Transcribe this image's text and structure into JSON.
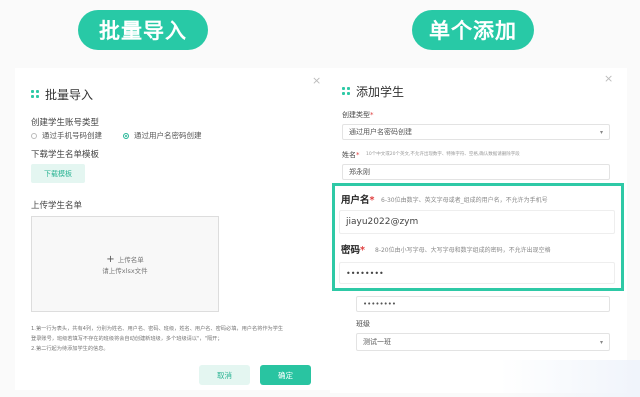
{
  "labels": {
    "left": "批量导入",
    "right": "单个添加"
  },
  "batch": {
    "close": "×",
    "title": "批量导入",
    "account_type_label": "创建学生账号类型",
    "radio_phone": "通过手机号码创建",
    "radio_username": "通过用户名密码创建",
    "download_label": "下载学生名单模板",
    "download_button": "下载模板",
    "upload_label": "上传学生名单",
    "upload_title": "上传名单",
    "upload_hint": "请上传xlsx文件",
    "note1": "1.第一行为表头，共有4列，分别为姓名、用户名、密码、班级，姓名、用户名、密码必填，用户名将作为学生",
    "note2": "登录账号，班级若填写不存在的班级将会自动创建新班级，多个班级请以\"，\"隔开；",
    "note3": "2.第二行起为待添加学生的信息。",
    "cancel": "取消",
    "confirm": "确定"
  },
  "single": {
    "close": "×",
    "title": "添加学生",
    "type_label": "创建类型",
    "type_value": "通过用户名密码创建",
    "name_label": "姓名",
    "name_hint": "10个中文或20个英文,不允许出现数字、特殊字符、空格,确认数据请删除字段",
    "name_value": "郑永刚",
    "username_label": "用户名",
    "username_hint": "6-30位由数字、英文字母或者_组成的用户名，不允许为手机号",
    "username_value": "jiayu2022@zym",
    "password_label": "密码",
    "password_hint": "8-20位由小写字母、大写字母和数字组成的密码，不允许出现空格",
    "password_value": "••••••••",
    "password_field_value": "••••••••",
    "class_label": "班级",
    "class_value": "测试一班"
  },
  "colors": {
    "accent": "#28c9a6",
    "required": "#e04040"
  }
}
